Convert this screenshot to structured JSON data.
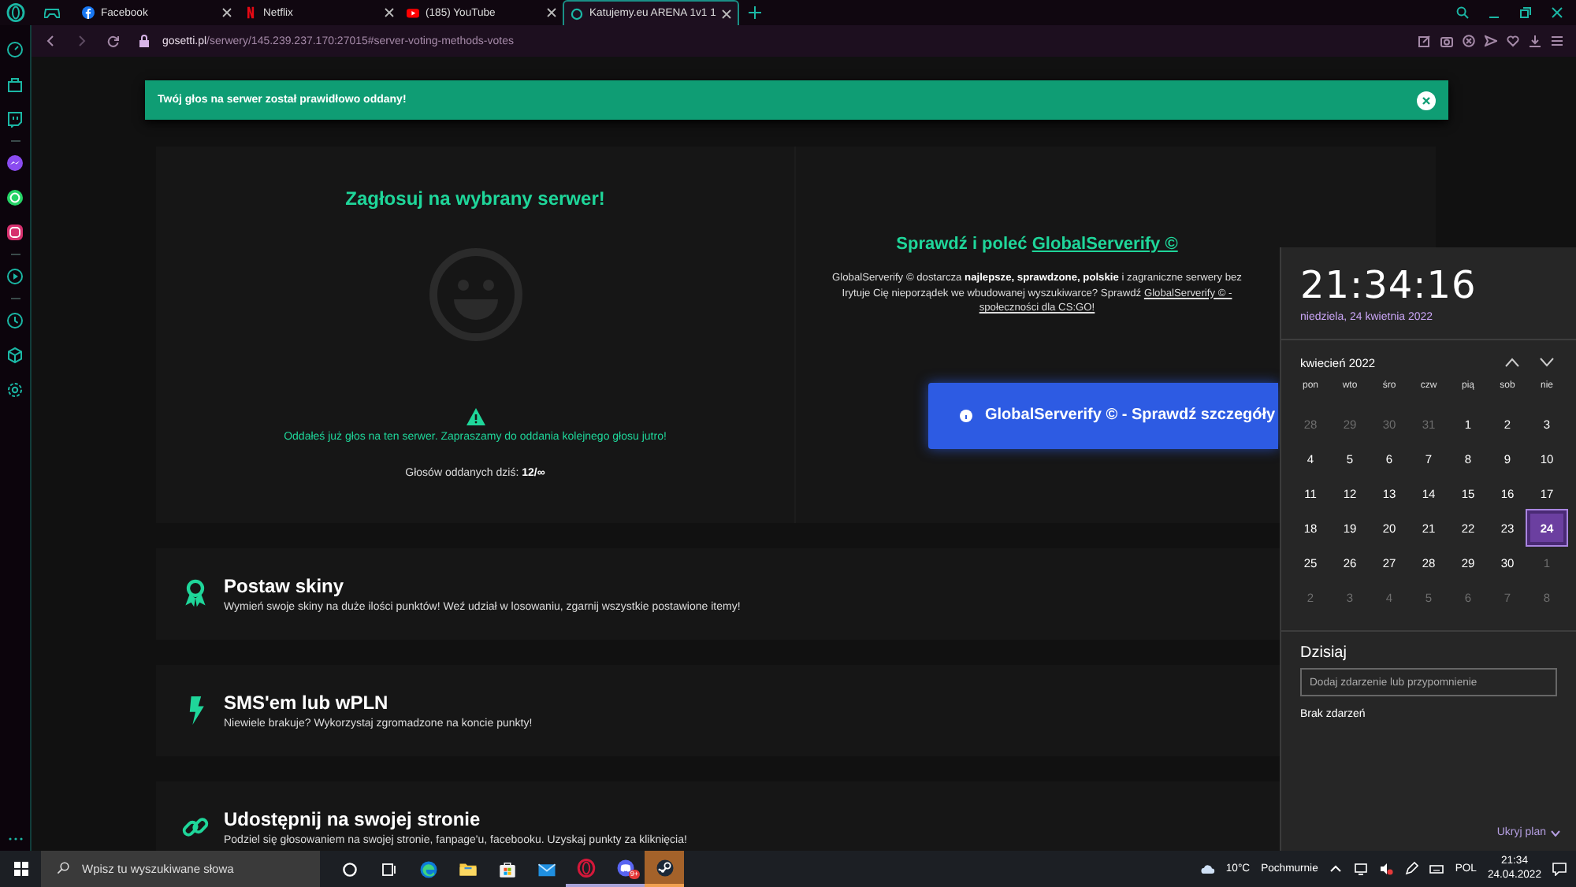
{
  "tabs": [
    {
      "kind": "facebook",
      "label": "Facebook",
      "selected": false
    },
    {
      "kind": "netflix",
      "label": "Netflix",
      "selected": false
    },
    {
      "kind": "youtube",
      "label": "(185) YouTube",
      "selected": false
    },
    {
      "kind": "site",
      "label": "Katujemy.eu ARENA 1v1 1",
      "selected": true
    }
  ],
  "address_bar": {
    "host": "gosetti.pl",
    "path": "/serwery/145.239.237.170:27015#server-voting-methods-votes"
  },
  "alert": {
    "message": "Twój głos na serwer został prawidłowo oddany!"
  },
  "vote_panel": {
    "title": "Zagłosuj na wybrany serwer!",
    "notice": "Oddałeś już głos na ten serwer. Zapraszamy do oddania kolejnego głosu jutro!",
    "votes_today": "Głosów oddanych dziś: **12/∞**"
  },
  "promo": {
    "heading": "Sprawdź i poleć",
    "heading_link": "GlobalServerify ©",
    "line1": "GlobalServerify © dostarcza **najlepsze, sprawdzone, polskie** i zagraniczne serwery bez",
    "line2": "Irytuje Cię nieporządek we wbudowanej wyszukiwarce? Sprawdź",
    "line2_link": "GlobalServerify © -",
    "line3_link": "społeczności dla CS:GO!",
    "button": "GlobalServerify © - Sprawdź szczegóły"
  },
  "features": [
    {
      "kind": "award",
      "title": "Postaw skiny",
      "description": "Wymień swoje skiny na duże ilości punktów! Weź udział w losowaniu, zgarnij wszystkie postawione itemy!"
    },
    {
      "kind": "bolt",
      "title": "SMS'em lub wPLN",
      "description": "Niewiele brakuje? Wykorzystaj zgromadzone na koncie punkty!"
    },
    {
      "kind": "link",
      "title": "Udostępnij na swojej stronie",
      "description": "Podziel się głosowaniem na swojej stronie, fanpage'u, facebooku. Uzyskaj punkty za kliknięcia!"
    }
  ],
  "calendar": {
    "time": "21:34:16",
    "date": "niedziela, 24 kwietnia 2022",
    "month": "kwiecień 2022",
    "weekdays": [
      "pon",
      "wto",
      "śro",
      "czw",
      "pią",
      "sob",
      "nie"
    ],
    "days": [
      {
        "day": "28",
        "in_month": false,
        "selected": false
      },
      {
        "day": "29",
        "in_month": false,
        "selected": false
      },
      {
        "day": "30",
        "in_month": false,
        "selected": false
      },
      {
        "day": "31",
        "in_month": false,
        "selected": false
      },
      {
        "day": "1",
        "in_month": true,
        "selected": false
      },
      {
        "day": "2",
        "in_month": true,
        "selected": false
      },
      {
        "day": "3",
        "in_month": true,
        "selected": false
      },
      {
        "day": "4",
        "in_month": true,
        "selected": false
      },
      {
        "day": "5",
        "in_month": true,
        "selected": false
      },
      {
        "day": "6",
        "in_month": true,
        "selected": false
      },
      {
        "day": "7",
        "in_month": true,
        "selected": false
      },
      {
        "day": "8",
        "in_month": true,
        "selected": false
      },
      {
        "day": "9",
        "in_month": true,
        "selected": false
      },
      {
        "day": "10",
        "in_month": true,
        "selected": false
      },
      {
        "day": "11",
        "in_month": true,
        "selected": false
      },
      {
        "day": "12",
        "in_month": true,
        "selected": false
      },
      {
        "day": "13",
        "in_month": true,
        "selected": false
      },
      {
        "day": "14",
        "in_month": true,
        "selected": false
      },
      {
        "day": "15",
        "in_month": true,
        "selected": false
      },
      {
        "day": "16",
        "in_month": true,
        "selected": false
      },
      {
        "day": "17",
        "in_month": true,
        "selected": false
      },
      {
        "day": "18",
        "in_month": true,
        "selected": false
      },
      {
        "day": "19",
        "in_month": true,
        "selected": false
      },
      {
        "day": "20",
        "in_month": true,
        "selected": false
      },
      {
        "day": "21",
        "in_month": true,
        "selected": false
      },
      {
        "day": "22",
        "in_month": true,
        "selected": false
      },
      {
        "day": "23",
        "in_month": true,
        "selected": false
      },
      {
        "day": "24",
        "in_month": true,
        "selected": true
      },
      {
        "day": "25",
        "in_month": true,
        "selected": false
      },
      {
        "day": "26",
        "in_month": true,
        "selected": false
      },
      {
        "day": "27",
        "in_month": true,
        "selected": false
      },
      {
        "day": "28",
        "in_month": true,
        "selected": false
      },
      {
        "day": "29",
        "in_month": true,
        "selected": false
      },
      {
        "day": "30",
        "in_month": true,
        "selected": false
      },
      {
        "day": "1",
        "in_month": false,
        "selected": false
      },
      {
        "day": "2",
        "in_month": false,
        "selected": false
      },
      {
        "day": "3",
        "in_month": false,
        "selected": false
      },
      {
        "day": "4",
        "in_month": false,
        "selected": false
      },
      {
        "day": "5",
        "in_month": false,
        "selected": false
      },
      {
        "day": "6",
        "in_month": false,
        "selected": false
      },
      {
        "day": "7",
        "in_month": false,
        "selected": false
      },
      {
        "day": "8",
        "in_month": false,
        "selected": false
      }
    ],
    "agenda_title": "Dzisiaj",
    "event_placeholder": "Dodaj zdarzenie lub przypomnienie",
    "no_events": "Brak zdarzeń",
    "hide_plan": "Ukryj plan"
  },
  "taskbar": {
    "search_placeholder": "Wpisz tu wyszukiwane słowa",
    "apps": [
      {
        "kind": "edge",
        "running": false,
        "selected": false
      },
      {
        "kind": "explorer",
        "running": false,
        "selected": false
      },
      {
        "kind": "store",
        "running": false,
        "selected": false
      },
      {
        "kind": "mail",
        "running": false,
        "selected": false
      },
      {
        "kind": "opera",
        "running": true,
        "selected": false
      },
      {
        "kind": "discord",
        "running": true,
        "selected": false,
        "badge": "9+"
      },
      {
        "kind": "steam",
        "running": true,
        "selected": true
      }
    ],
    "temperature": "10°C",
    "weather": "Pochmurnie",
    "language": "POL",
    "time": "21:34",
    "date": "24.04.2022"
  }
}
